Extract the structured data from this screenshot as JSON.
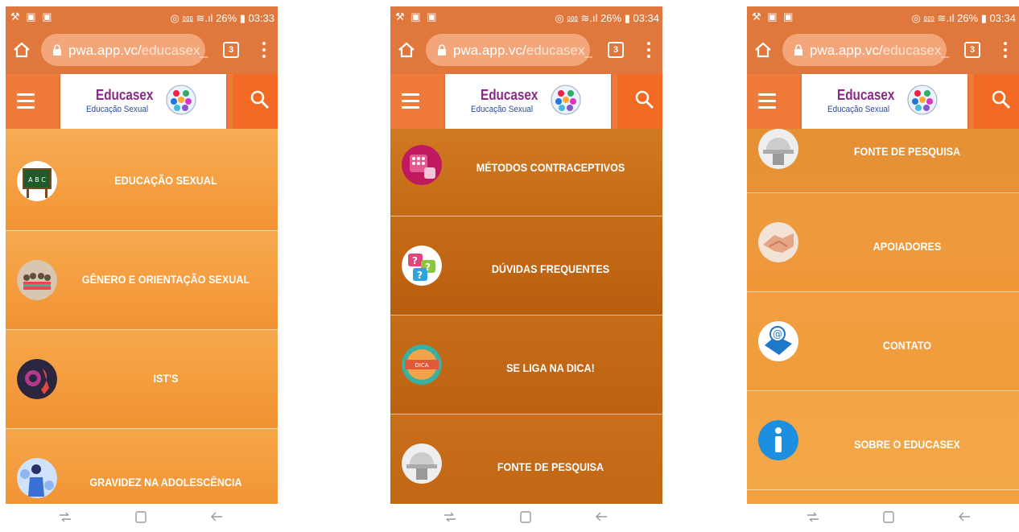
{
  "brand": {
    "name": "Educasex",
    "tagline": "Educação Sexual"
  },
  "colors": {
    "statusbar": "#e0773c",
    "appbar": "#f07a3a",
    "orange_light": "#f6a24a",
    "orange_dark": "#c66b14"
  },
  "nav_icons": [
    "recent-apps-icon",
    "home-square-icon",
    "back-arrow-icon"
  ],
  "phones": [
    {
      "status": {
        "left": "⚒ ▣ ▣",
        "right": "◎ ⅏ ≋.ıl 26% ▮ 03:33"
      },
      "url": {
        "host": "pwa.app.vc/",
        "path": "educasex_"
      },
      "tab_count": "3",
      "items": [
        {
          "label": "EDUCAÇÃO SEXUAL",
          "icon": "chalkboard-icon"
        },
        {
          "label": "GÊNERO E ORIENTAÇÃO SEXUAL",
          "icon": "people-group-icon"
        },
        {
          "label": "IST'S",
          "icon": "ribbon-icon"
        },
        {
          "label": "GRAVIDEZ NA ADOLESCÊNCIA",
          "icon": "pregnancy-icon"
        }
      ]
    },
    {
      "status": {
        "left": "⚒ ▣ ▣",
        "right": "◎ ⅏ ≋.ıl 26% ▮ 03:34"
      },
      "url": {
        "host": "pwa.app.vc/",
        "path": "educasex_"
      },
      "tab_count": "3",
      "items": [
        {
          "label": "MÉTODOS CONTRACEPTIVOS",
          "icon": "pill-pack-icon"
        },
        {
          "label": "DÚVIDAS FREQUENTES",
          "icon": "question-marks-icon"
        },
        {
          "label": "SE LIGA NA DICA!",
          "icon": "tip-badge-icon"
        },
        {
          "label": "FONTE DE PESQUISA",
          "icon": "hardhat-icon"
        }
      ]
    },
    {
      "status": {
        "left": "⚒ ▣ ▣",
        "right": "◎ ⅏ ≋.ıl 26% ▮ 03:34"
      },
      "url": {
        "host": "pwa.app.vc/",
        "path": "educasex_"
      },
      "tab_count": "3",
      "items": [
        {
          "label": "FONTE DE PESQUISA",
          "icon": "hardhat-icon"
        },
        {
          "label": "APOIADORES",
          "icon": "handshake-icon"
        },
        {
          "label": "CONTATO",
          "icon": "email-at-icon"
        },
        {
          "label": "SOBRE O EDUCASEX",
          "icon": "info-icon"
        }
      ]
    }
  ]
}
